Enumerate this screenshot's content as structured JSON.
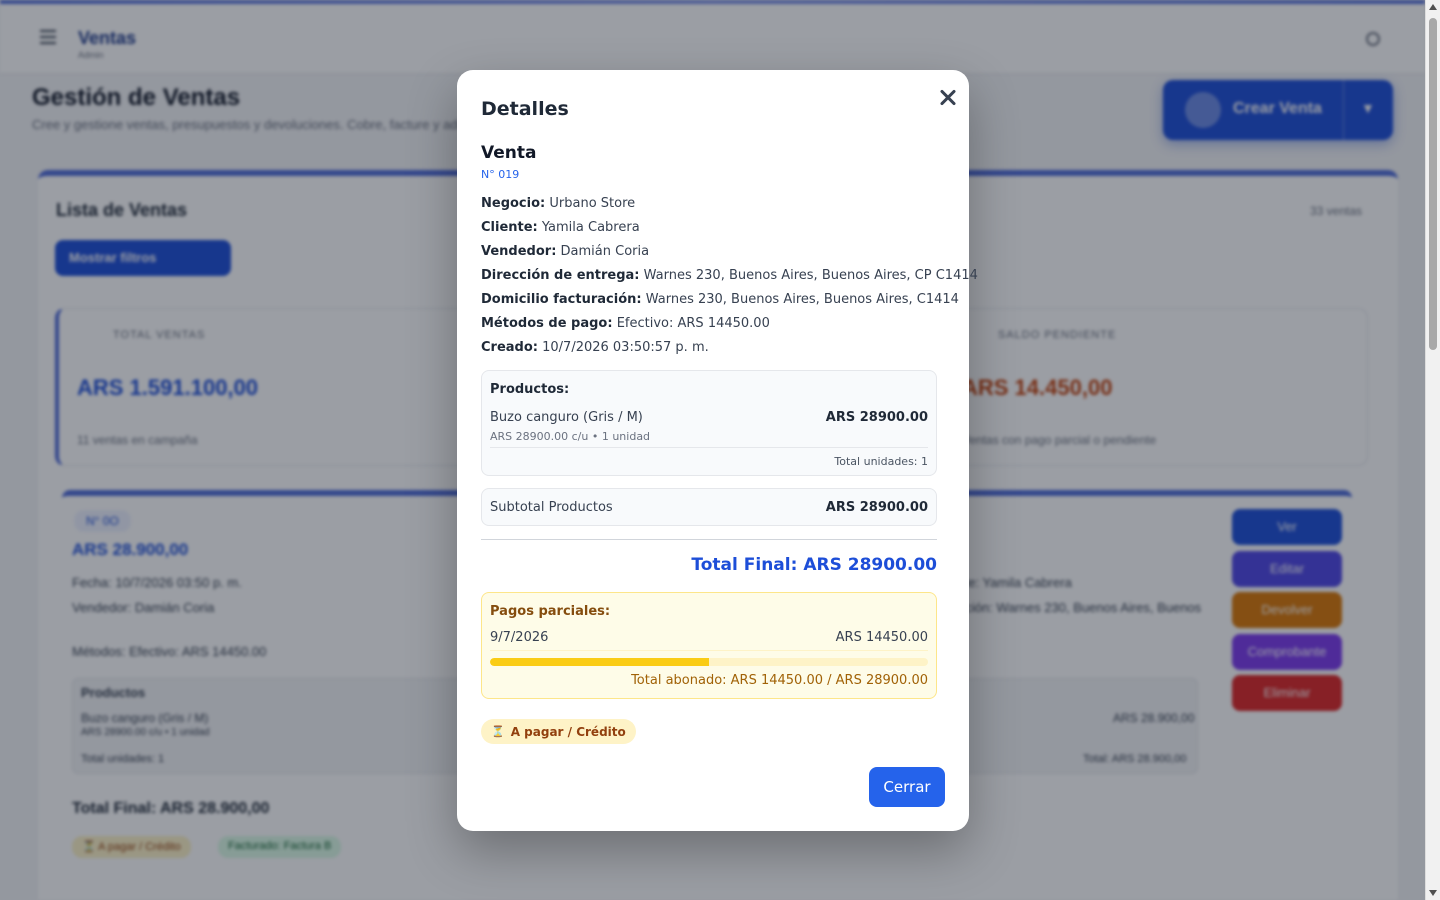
{
  "background": {
    "header": {
      "title": "Ventas",
      "subtitle": "Admin"
    },
    "page_title": "Gestión de Ventas",
    "page_description": "Cree y gestione ventas, presupuestos y devoluciones. Cobre, facture y administre sus operaciones",
    "create_button_label": "Crear Venta",
    "list_title": "Lista de Ventas",
    "list_count": "33 ventas",
    "filter_button_label": "Mostrar filtros",
    "stats": [
      {
        "label": "TOTAL VENTAS",
        "value": "ARS 1.591.100,00",
        "footer": "11 ventas en campaña",
        "color": "#1d4ed8"
      },
      {
        "label": "SALDO PENDIENTE",
        "value": "ARS 14.450,00",
        "footer": "Ventas con pago parcial o pendiente",
        "color": "#c2410c"
      }
    ],
    "sale_card": {
      "number": "N° 0O",
      "amount": "ARS 28.900,00",
      "date_line": "Fecha: 10/7/2026 03:50 p. m.",
      "seller_line": "Vendedor: Damián Coria",
      "client_line": "Cliente: Yamila Cabrera",
      "address_line": "Dirección: Warnes 230, Buenos Aires, Buenos",
      "methods_line": "Métodos: Efectivo: ARS 14450.00",
      "products_heading": "Productos",
      "product_line": "Buzo canguro (Gris / M)",
      "product_detail": "ARS 28900.00 c/u • 1 unidad",
      "product_price": "ARS 28.900,00",
      "units_line": "Total unidades: 1",
      "units_total": "Total: ARS 28.900,00",
      "total_final": "Total Final: ARS 28.900,00",
      "chips": [
        "⏳ A pagar / Crédito",
        "Facturado: Factura B"
      ]
    },
    "actions": [
      {
        "label": "Ver",
        "color": "#1d4ed8"
      },
      {
        "label": "Editar",
        "color": "#4f46e5"
      },
      {
        "label": "Devolver",
        "color": "#d97706"
      },
      {
        "label": "Comprobante",
        "color": "#7c3aed"
      },
      {
        "label": "Eliminar",
        "color": "#dc2626"
      }
    ]
  },
  "modal": {
    "title": "Detalles",
    "doc_type": "Venta",
    "doc_number": "N° 019",
    "fields": [
      {
        "label": "Negocio:",
        "value": "Urbano Store"
      },
      {
        "label": "Cliente:",
        "value": "Yamila Cabrera"
      },
      {
        "label": "Vendedor:",
        "value": "Damián Coria"
      },
      {
        "label": "Dirección de entrega:",
        "value": "Warnes 230, Buenos Aires, Buenos Aires, CP C1414"
      },
      {
        "label": "Domicilio facturación:",
        "value": "Warnes 230, Buenos Aires, Buenos Aires, C1414"
      },
      {
        "label": "Métodos de pago:",
        "value": "Efectivo: ARS 14450.00"
      },
      {
        "label": "Creado:",
        "value": "10/7/2026 03:50:57 p. m."
      }
    ],
    "products": {
      "heading": "Productos:",
      "items": [
        {
          "name": "Buzo canguro (Gris / M)",
          "price": "ARS 28900.00",
          "detail": "ARS 28900.00 c/u • 1 unidad"
        }
      ],
      "total_units": "Total unidades: 1"
    },
    "subtotal": {
      "label": "Subtotal Productos",
      "value": "ARS 28900.00"
    },
    "total_final": "Total Final: ARS 28900.00",
    "payments": {
      "heading": "Pagos parciales:",
      "items": [
        {
          "date": "9/7/2026",
          "amount": "ARS 14450.00"
        }
      ],
      "progress": 0.5,
      "total_paid": "Total abonado: ARS 14450.00 / ARS 28900.00"
    },
    "status_chip": {
      "icon": "hourglass-icon",
      "label": "A pagar / Crédito"
    },
    "close_button": "Cerrar"
  }
}
